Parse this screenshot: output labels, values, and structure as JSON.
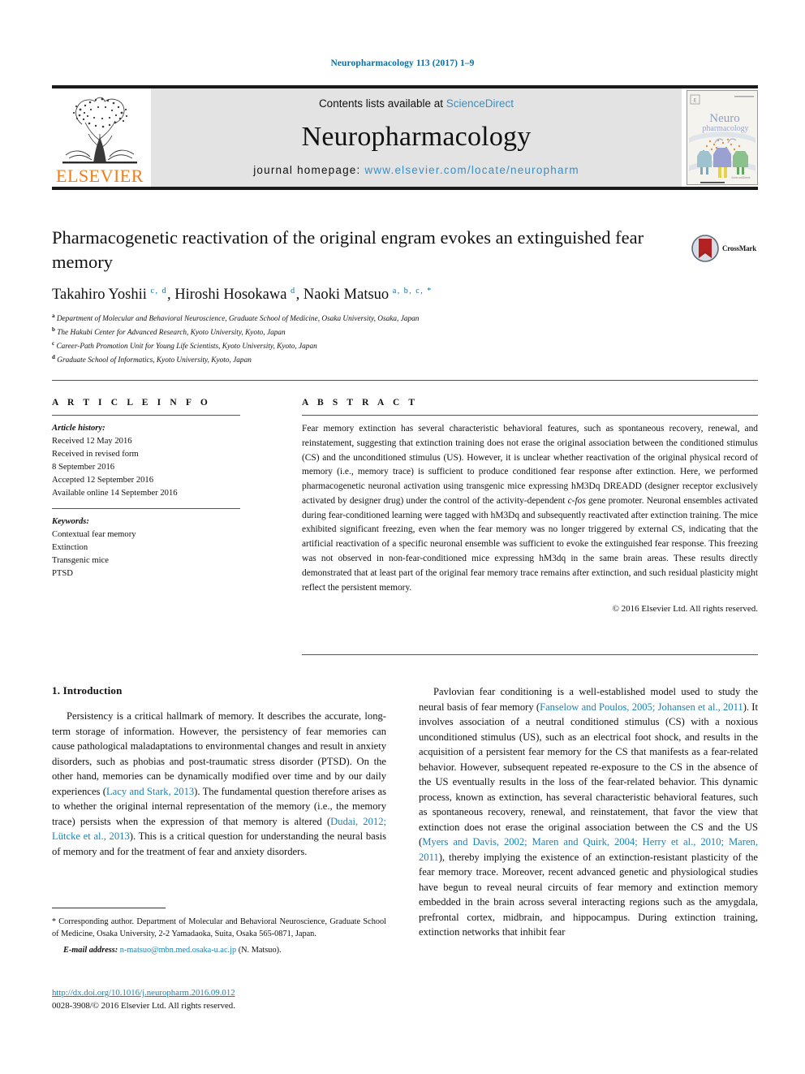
{
  "running_head": "Neuropharmacology 113 (2017) 1–9",
  "masthead": {
    "publisher": "ELSEVIER",
    "contents_prefix": "Contents lists available at ",
    "contents_link": "ScienceDirect",
    "journal_title": "Neuropharmacology",
    "homepage_prefix": "journal homepage: ",
    "homepage_url": "www.elsevier.com/locate/neuropharm",
    "cover_title_line1": "Neuro",
    "cover_title_line2": "pharmacology"
  },
  "article": {
    "title": "Pharmacogenetic reactivation of the original engram evokes an extinguished fear memory",
    "authors_html": "Takahiro Yoshii <sup>c, d</sup>, Hiroshi Hosokawa <sup>d</sup>, Naoki Matsuo <sup>a, b, c, *</sup>",
    "affiliations": [
      {
        "marker": "a",
        "text": "Department of Molecular and Behavioral Neuroscience, Graduate School of Medicine, Osaka University, Osaka, Japan"
      },
      {
        "marker": "b",
        "text": "The Hakubi Center for Advanced Research, Kyoto University, Kyoto, Japan"
      },
      {
        "marker": "c",
        "text": "Career-Path Promotion Unit for Young Life Scientists, Kyoto University, Kyoto, Japan"
      },
      {
        "marker": "d",
        "text": "Graduate School of Informatics, Kyoto University, Kyoto, Japan"
      }
    ],
    "crossmark_label": "CrossMark"
  },
  "article_info": {
    "heading": "A R T I C L E    I N F O",
    "history_label": "Article history:",
    "history": [
      "Received 12 May 2016",
      "Received in revised form",
      "8 September 2016",
      "Accepted 12 September 2016",
      "Available online 14 September 2016"
    ],
    "keywords_label": "Keywords:",
    "keywords": [
      "Contextual fear memory",
      "Extinction",
      "Transgenic mice",
      "PTSD"
    ]
  },
  "abstract": {
    "heading": "A B S T R A C T",
    "text_html": "Fear memory extinction has several characteristic behavioral features, such as spontaneous recovery, renewal, and reinstatement, suggesting that extinction training does not erase the original association between the conditioned stimulus (CS) and the unconditioned stimulus (US). However, it is unclear whether reactivation of the original physical record of memory (i.e., memory trace) is sufficient to produce conditioned fear response after extinction. Here, we performed pharmacogenetic neuronal activation using transgenic mice expressing hM3Dq DREADD (designer receptor exclusively activated by designer drug) under the control of the activity-dependent <i>c-fos</i> gene promoter. Neuronal ensembles activated during fear-conditioned learning were tagged with hM3Dq and subsequently reactivated after extinction training. The mice exhibited significant freezing, even when the fear memory was no longer triggered by external CS, indicating that the artificial reactivation of a specific neuronal ensemble was sufficient to evoke the extinguished fear response. This freezing was not observed in non-fear-conditioned mice expressing hM3dq in the same brain areas. These results directly demonstrated that at least part of the original fear memory trace remains after extinction, and such residual plasticity might reflect the persistent memory.",
    "copyright": "© 2016 Elsevier Ltd. All rights reserved."
  },
  "body": {
    "section_heading": "1. Introduction",
    "left_paragraph_html": "Persistency is a critical hallmark of memory. It describes the accurate, long-term storage of information. However, the persistency of fear memories can cause pathological maladaptations to environmental changes and result in anxiety disorders, such as phobias and post-traumatic stress disorder (PTSD). On the other hand, memories can be dynamically modified over time and by our daily experiences (<span class=\"ref\">Lacy and Stark, 2013</span>). The fundamental question therefore arises as to whether the original internal representation of the memory (i.e., the memory trace) persists when the expression of that memory is altered (<span class=\"ref\">Dudai, 2012; Lütcke et al., 2013</span>). This is a critical question for understanding the neural basis of memory and for the treatment of fear and anxiety disorders.",
    "right_paragraph_html": "Pavlovian fear conditioning is a well-established model used to study the neural basis of fear memory (<span class=\"ref\">Fanselow and Poulos, 2005; Johansen et al., 2011</span>). It involves association of a neutral conditioned stimulus (CS) with a noxious unconditioned stimulus (US), such as an electrical foot shock, and results in the acquisition of a persistent fear memory for the CS that manifests as a fear-related behavior. However, subsequent repeated re-exposure to the CS in the absence of the US eventually results in the loss of the fear-related behavior. This dynamic process, known as extinction, has several characteristic behavioral features, such as spontaneous recovery, renewal, and reinstatement, that favor the view that extinction does not erase the original association between the CS and the US (<span class=\"ref\">Myers and Davis, 2002; Maren and Quirk, 2004; Herry et al., 2010; Maren, 2011</span>), thereby implying the existence of an extinction-resistant plasticity of the fear memory trace. Moreover, recent advanced genetic and physiological studies have begun to reveal neural circuits of fear memory and extinction memory embedded in the brain across several interacting regions such as the amygdala, prefrontal cortex, midbrain, and hippocampus. During extinction training, extinction networks that inhibit fear"
  },
  "footnotes": {
    "corresponding_html": "<span class=\"star\">*</span> Corresponding author. Department of Molecular and Behavioral Neuroscience, Graduate School of Medicine, Osaka University, 2-2 Yamadaoka, Suita, Osaka 565-0871, Japan.",
    "email_label": "E-mail address:",
    "email": "n-matsuo@mbn.med.osaka-u.ac.jp",
    "email_suffix": "(N. Matsuo).",
    "doi": "http://dx.doi.org/10.1016/j.neuropharm.2016.09.012",
    "issn_line": "0028-3908/© 2016 Elsevier Ltd. All rights reserved."
  },
  "colors": {
    "link_blue": "#1b82b5",
    "header_blue": "#0b6fa4",
    "elsevier_orange": "#ef7d1a",
    "masthead_gray": "#e3e3e3"
  }
}
